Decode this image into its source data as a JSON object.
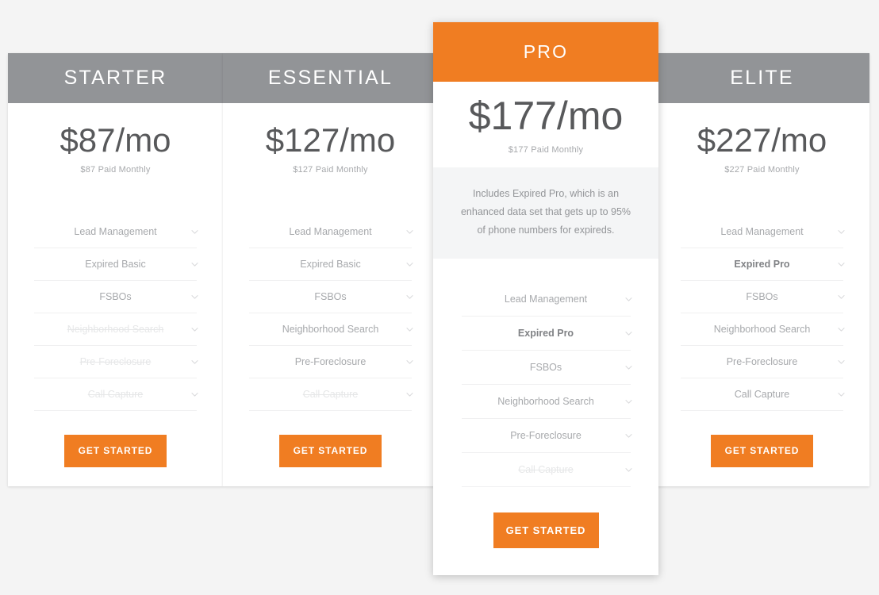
{
  "accent_color": "#f07d22",
  "header_gray": "#929497",
  "page_bg": "#f4f4f4",
  "cta_label": "GET STARTED",
  "chevron_icon": "chevron-down-icon",
  "plans": [
    {
      "name": "STARTER",
      "price": "$87/mo",
      "price_sub": "$87 Paid Monthly",
      "featured": false,
      "description": "",
      "cta_label": "GET STARTED",
      "features": [
        {
          "label": "Lead Management",
          "state": "normal"
        },
        {
          "label": "Expired Basic",
          "state": "normal"
        },
        {
          "label": "FSBOs",
          "state": "normal"
        },
        {
          "label": "Neighborhood Search",
          "state": "disabled"
        },
        {
          "label": "Pre-Foreclosure",
          "state": "disabled"
        },
        {
          "label": "Call Capture",
          "state": "disabled"
        }
      ]
    },
    {
      "name": "ESSENTIAL",
      "price": "$127/mo",
      "price_sub": "$127 Paid Monthly",
      "featured": false,
      "description": "",
      "cta_label": "GET STARTED",
      "features": [
        {
          "label": "Lead Management",
          "state": "normal"
        },
        {
          "label": "Expired Basic",
          "state": "normal"
        },
        {
          "label": "FSBOs",
          "state": "normal"
        },
        {
          "label": "Neighborhood Search",
          "state": "normal"
        },
        {
          "label": "Pre-Foreclosure",
          "state": "normal"
        },
        {
          "label": "Call Capture",
          "state": "disabled"
        }
      ]
    },
    {
      "name": "PRO",
      "price": "$177/mo",
      "price_sub": "$177 Paid Monthly",
      "featured": true,
      "description": "Includes Expired Pro, which is an enhanced data set that gets up to 95% of phone numbers for expireds.",
      "cta_label": "GET STARTED",
      "features": [
        {
          "label": "Lead Management",
          "state": "normal"
        },
        {
          "label": "Expired Pro",
          "state": "highlight"
        },
        {
          "label": "FSBOs",
          "state": "normal"
        },
        {
          "label": "Neighborhood Search",
          "state": "normal"
        },
        {
          "label": "Pre-Foreclosure",
          "state": "normal"
        },
        {
          "label": "Call Capture",
          "state": "disabled"
        }
      ]
    },
    {
      "name": "ELITE",
      "price": "$227/mo",
      "price_sub": "$227 Paid Monthly",
      "featured": false,
      "description": "",
      "cta_label": "GET STARTED",
      "features": [
        {
          "label": "Lead Management",
          "state": "normal"
        },
        {
          "label": "Expired Pro",
          "state": "highlight"
        },
        {
          "label": "FSBOs",
          "state": "normal"
        },
        {
          "label": "Neighborhood Search",
          "state": "normal"
        },
        {
          "label": "Pre-Foreclosure",
          "state": "normal"
        },
        {
          "label": "Call Capture",
          "state": "normal"
        }
      ]
    }
  ]
}
